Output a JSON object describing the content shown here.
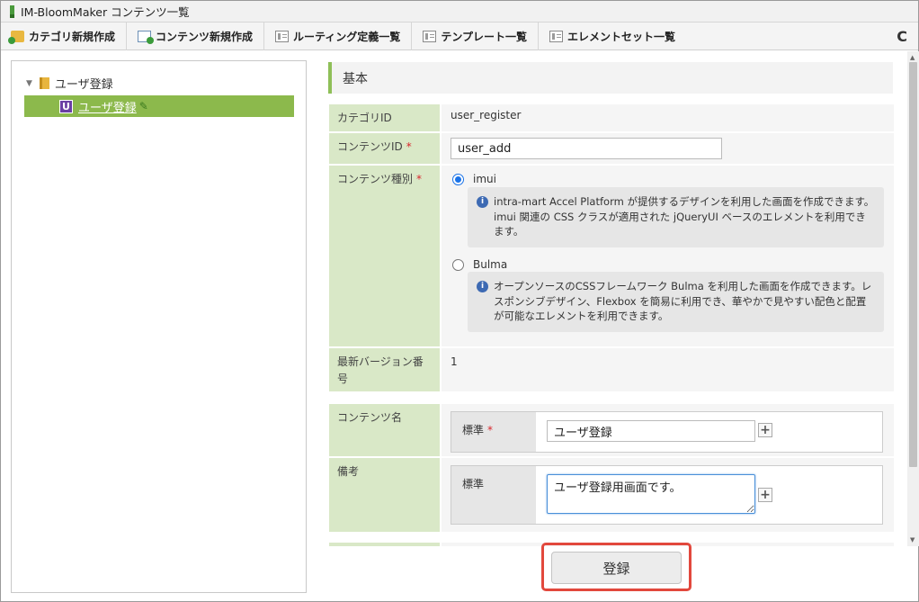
{
  "window": {
    "title": "IM-BloomMaker コンテンツ一覧"
  },
  "toolbar": {
    "new_category": "カテゴリ新規作成",
    "new_content": "コンテンツ新規作成",
    "routing_list": "ルーティング定義一覧",
    "template_list": "テンプレート一覧",
    "element_set_list": "エレメントセット一覧",
    "refresh_glyph": "C"
  },
  "tree": {
    "root_label": "ユーザ登録",
    "child_label": "ユーザ登録",
    "child_badge": "U"
  },
  "form": {
    "section_title": "基本",
    "category_id": {
      "label": "カテゴリID",
      "value": "user_register"
    },
    "content_id": {
      "label": "コンテンツID",
      "required": "*",
      "value": "user_add"
    },
    "content_type": {
      "label": "コンテンツ種別",
      "required": "*",
      "options": [
        {
          "label": "imui",
          "selected": true,
          "description": "intra-mart Accel Platform が提供するデザインを利用した画面を作成できます。imui 関連の CSS クラスが適用された jQueryUI ベースのエレメントを利用できます。"
        },
        {
          "label": "Bulma",
          "selected": false,
          "description": "オープンソースのCSSフレームワーク Bulma を利用した画面を作成できます。レスポンシブデザイン、Flexbox を簡易に利用でき、華やかで見やすい配色と配置が可能なエレメントを利用できます。"
        }
      ]
    },
    "latest_version": {
      "label": "最新バージョン番号",
      "value": "1"
    },
    "content_name": {
      "label": "コンテンツ名",
      "locale_label": "標準",
      "required": "*",
      "value": "ユーザ登録",
      "add_glyph": "+"
    },
    "remarks": {
      "label": "備考",
      "locale_label": "標準",
      "value": "ユーザ登録用画面です。",
      "add_glyph": "+"
    }
  },
  "actions": {
    "submit_label": "登録"
  }
}
